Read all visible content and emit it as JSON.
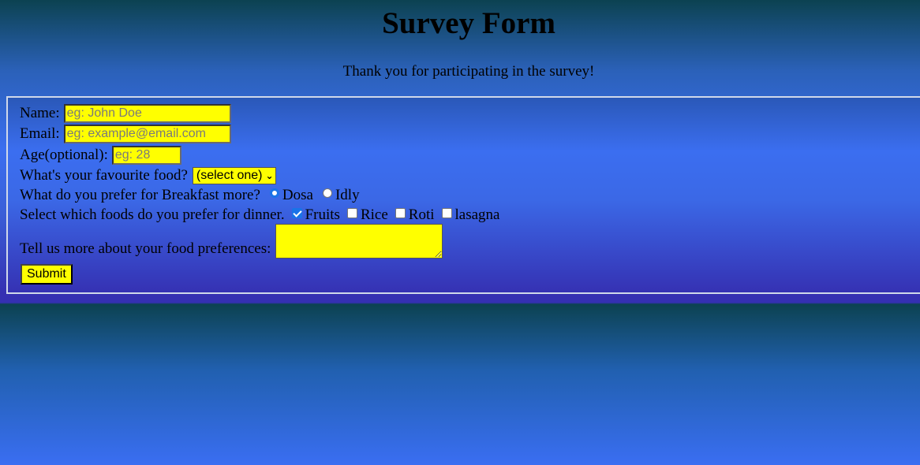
{
  "page": {
    "title": "Survey Form",
    "description": "Thank you for participating in the survey!"
  },
  "form": {
    "name": {
      "label": "Name:",
      "placeholder": "eg: John Doe",
      "value": ""
    },
    "email": {
      "label": "Email:",
      "placeholder": "eg: example@email.com",
      "value": ""
    },
    "age": {
      "label": "Age(optional):",
      "placeholder": "eg: 28",
      "value": ""
    },
    "food": {
      "label": "What's your favourite food?",
      "selected": "(select one)"
    },
    "breakfast": {
      "label": "What do you prefer for Breakfast more?",
      "options": [
        {
          "label": "Dosa",
          "checked": true
        },
        {
          "label": "Idly",
          "checked": false
        }
      ]
    },
    "dinner": {
      "label": "Select which foods do you prefer for dinner.",
      "options": [
        {
          "label": "Fruits",
          "checked": true
        },
        {
          "label": "Rice",
          "checked": false
        },
        {
          "label": "Roti",
          "checked": false
        },
        {
          "label": "lasagna",
          "checked": false
        }
      ]
    },
    "preferences": {
      "label": "Tell us more about your food preferences:",
      "value": ""
    },
    "submit_label": "Submit"
  },
  "colors": {
    "field_background": "#ffff00",
    "accent": "#1a73e8"
  }
}
